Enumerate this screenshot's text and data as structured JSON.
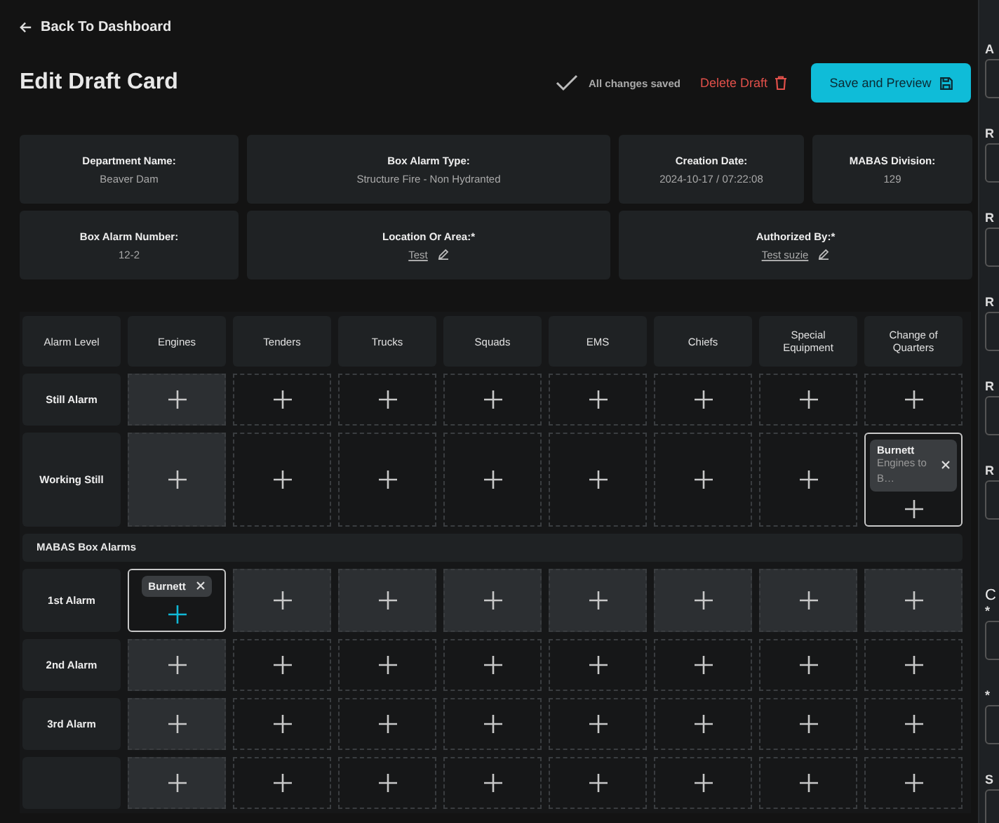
{
  "back_link": "Back To Dashboard",
  "title": "Edit Draft Card",
  "save_status": "All changes saved",
  "delete_button": "Delete Draft",
  "save_button": "Save and Preview",
  "info_cards": [
    {
      "label": "Department Name:",
      "value": "Beaver Dam",
      "editable": false
    },
    {
      "label": "Box Alarm Type:",
      "value": "Structure Fire - Non Hydranted",
      "editable": false
    },
    {
      "label": "Creation Date:",
      "value": "2024-10-17 / 07:22:08",
      "editable": false
    },
    {
      "label": "MABAS Division:",
      "value": "129",
      "editable": false
    },
    {
      "label": "Box Alarm Number:",
      "value": "12-2",
      "editable": false
    },
    {
      "label": "Location Or Area:*",
      "value": "Test",
      "editable": true
    },
    {
      "label": "Authorized By:*",
      "value": "Test suzie",
      "editable": true
    }
  ],
  "columns": [
    "Alarm Level",
    "Engines",
    "Tenders",
    "Trucks",
    "Squads",
    "EMS",
    "Chiefs",
    "Special Equipment",
    "Change of Quarters"
  ],
  "rows": [
    {
      "kind": "level",
      "label": "Still Alarm",
      "cells": [
        {
          "highlighted": true
        },
        {
          "highlighted": false
        },
        {
          "highlighted": false
        },
        {
          "highlighted": false
        },
        {
          "highlighted": false
        },
        {
          "highlighted": false
        },
        {
          "highlighted": false
        },
        {
          "highlighted": false
        }
      ]
    },
    {
      "kind": "level",
      "label": "Working Still",
      "cells": [
        {
          "highlighted": true
        },
        {
          "highlighted": false
        },
        {
          "highlighted": false
        },
        {
          "highlighted": false
        },
        {
          "highlighted": false
        },
        {
          "highlighted": false
        },
        {
          "highlighted": false
        },
        {
          "highlighted": false,
          "chips": [
            {
              "name": "Burnett",
              "detail": "Engines to B…"
            }
          ]
        }
      ]
    },
    {
      "kind": "section",
      "label": "MABAS Box Alarms"
    },
    {
      "kind": "level",
      "label": "1st Alarm",
      "cells": [
        {
          "highlighted": false,
          "focused": true,
          "chips": [
            {
              "name": "Burnett"
            }
          ]
        },
        {
          "highlighted": true
        },
        {
          "highlighted": true
        },
        {
          "highlighted": true
        },
        {
          "highlighted": true
        },
        {
          "highlighted": true
        },
        {
          "highlighted": true
        },
        {
          "highlighted": true
        }
      ]
    },
    {
      "kind": "level",
      "label": "2nd Alarm",
      "cells": [
        {
          "highlighted": true
        },
        {
          "highlighted": false
        },
        {
          "highlighted": false
        },
        {
          "highlighted": false
        },
        {
          "highlighted": false
        },
        {
          "highlighted": false
        },
        {
          "highlighted": false
        },
        {
          "highlighted": false
        }
      ]
    },
    {
      "kind": "level",
      "label": "3rd Alarm",
      "cells": [
        {
          "highlighted": true
        },
        {
          "highlighted": false
        },
        {
          "highlighted": false
        },
        {
          "highlighted": false
        },
        {
          "highlighted": false
        },
        {
          "highlighted": false
        },
        {
          "highlighted": false
        },
        {
          "highlighted": false
        }
      ]
    },
    {
      "kind": "level",
      "cells": [
        {
          "highlighted": true
        },
        {
          "highlighted": false
        },
        {
          "highlighted": false
        },
        {
          "highlighted": false
        },
        {
          "highlighted": false
        },
        {
          "highlighted": false
        },
        {
          "highlighted": false
        },
        {
          "highlighted": false
        }
      ]
    }
  ],
  "side_panel": [
    {
      "kind": "field",
      "label": "A"
    },
    {
      "kind": "field",
      "label": "R"
    },
    {
      "kind": "field",
      "label": "R"
    },
    {
      "kind": "field",
      "label": "R"
    },
    {
      "kind": "field",
      "label": "R"
    },
    {
      "kind": "field",
      "label": "R"
    },
    {
      "kind": "heading",
      "label": "C"
    },
    {
      "kind": "field",
      "label": "*"
    },
    {
      "kind": "field",
      "label": "*"
    },
    {
      "kind": "field",
      "label": "S"
    }
  ]
}
